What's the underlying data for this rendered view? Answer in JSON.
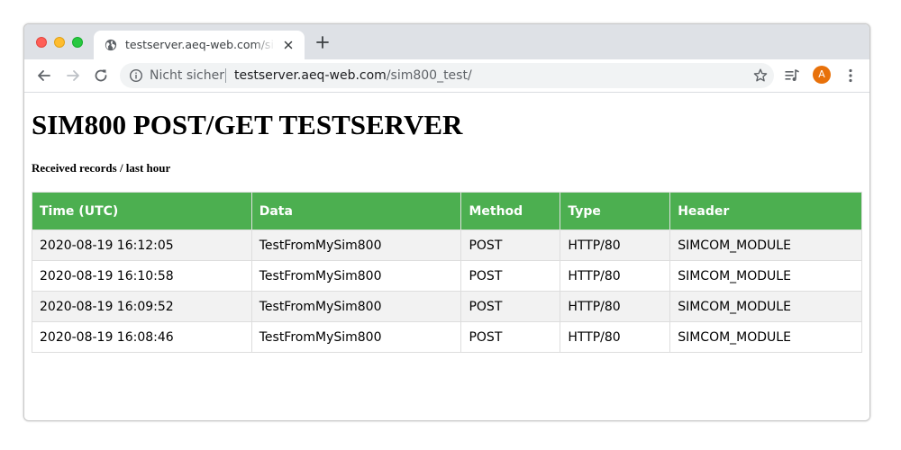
{
  "browser": {
    "tab_title": "testserver.aeq-web.com/sim800_test/",
    "security_label": "Nicht sicher",
    "url_host": "testserver.aeq-web.com",
    "url_path": "/sim800_test/",
    "profile_initial": "A",
    "profile_color": "#e8710a"
  },
  "page": {
    "title": "SIM800 POST/GET TESTSERVER",
    "subtitle": "Received records / last hour",
    "header_color": "#4caf50"
  },
  "table": {
    "columns": [
      "Time (UTC)",
      "Data",
      "Method",
      "Type",
      "Header"
    ],
    "rows": [
      [
        "2020-08-19 16:12:05",
        "TestFromMySim800",
        "POST",
        "HTTP/80",
        "SIMCOM_MODULE"
      ],
      [
        "2020-08-19 16:10:58",
        "TestFromMySim800",
        "POST",
        "HTTP/80",
        "SIMCOM_MODULE"
      ],
      [
        "2020-08-19 16:09:52",
        "TestFromMySim800",
        "POST",
        "HTTP/80",
        "SIMCOM_MODULE"
      ],
      [
        "2020-08-19 16:08:46",
        "TestFromMySim800",
        "POST",
        "HTTP/80",
        "SIMCOM_MODULE"
      ]
    ]
  }
}
